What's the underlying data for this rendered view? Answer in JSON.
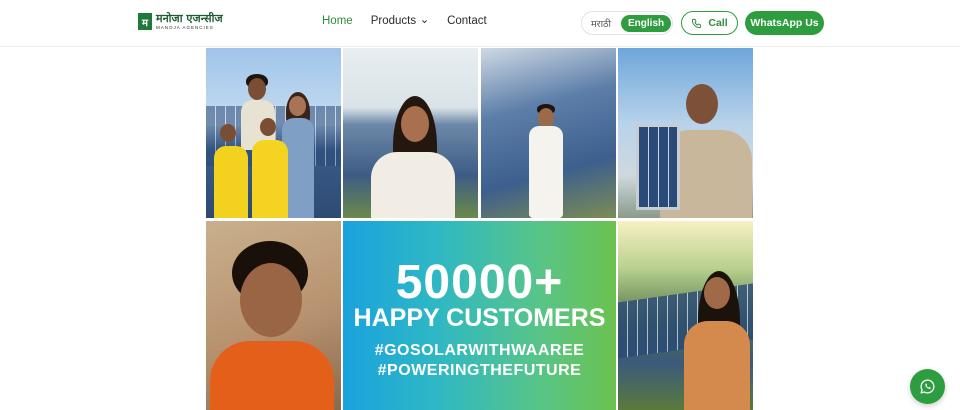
{
  "header": {
    "logo_mark": "म",
    "logo_name": "मनोजा एजन्सीज",
    "logo_sub": "MANOJA AGENCIES",
    "nav": [
      {
        "label": "Home",
        "active": true
      },
      {
        "label": "Products"
      },
      {
        "label": "Contact"
      }
    ],
    "lang_marathi": "मराठी",
    "lang_english": "English",
    "call_label": "Call",
    "whatsapp_label": "WhatsApp Us"
  },
  "promo": {
    "count": "50000+",
    "label": "HAPPY CUSTOMERS",
    "tag1": "#GOSOLARWITHWAAREE",
    "tag2": "#POWERINGTHEFUTURE"
  },
  "colors": {
    "brand_green": "#2e9d3f",
    "promo_gradient_start": "#1aa2de",
    "promo_gradient_end": "#6cc24f"
  },
  "icons": {
    "call": "phone-icon",
    "floating": "whatsapp-icon",
    "products": "chevron-down-icon"
  }
}
